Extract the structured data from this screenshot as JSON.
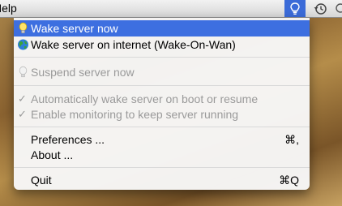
{
  "menubar": {
    "help_label": "Help",
    "active_icon": "lightbulb-icon",
    "clock_icon": "time-machine-icon"
  },
  "menu": {
    "items": [
      {
        "label": "Wake server now",
        "icon": "lightbulb-icon",
        "selected": true
      },
      {
        "label": "Wake server on internet (Wake-On-Wan)",
        "icon": "globe-icon"
      },
      {
        "label": "Suspend server now",
        "icon": "lightbulb-off-icon",
        "disabled": true
      },
      {
        "label": "Automatically wake server on boot or resume",
        "check": "✓",
        "disabled": true
      },
      {
        "label": "Enable monitoring to keep server running",
        "check": "✓",
        "disabled": true
      },
      {
        "label": "Preferences ...",
        "shortcut": "⌘,"
      },
      {
        "label": "About ..."
      },
      {
        "label": "Quit",
        "shortcut": "⌘Q"
      }
    ]
  },
  "colors": {
    "selection": "#3d6fe0",
    "disabled_text": "#9a9a9a"
  }
}
